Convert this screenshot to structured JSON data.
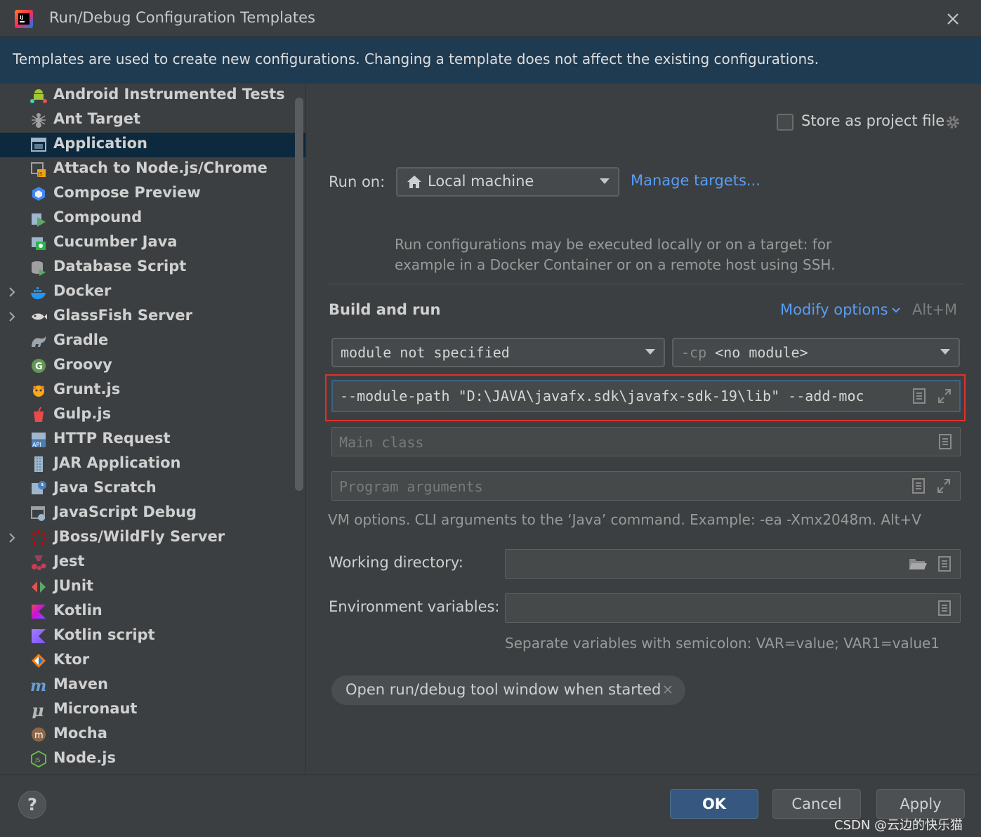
{
  "window": {
    "title": "Run/Debug Configuration Templates"
  },
  "banner": {
    "text": "Templates are used to create new configurations. Changing a template does not affect the existing configurations."
  },
  "sidebar": {
    "items": [
      {
        "label": "Android Instrumented Tests",
        "icon": "android-icon",
        "expandable": false
      },
      {
        "label": "Ant Target",
        "icon": "ant-icon",
        "expandable": false
      },
      {
        "label": "Application",
        "icon": "application-icon",
        "expandable": false,
        "selected": true
      },
      {
        "label": "Attach to Node.js/Chrome",
        "icon": "nodejs-attach-icon",
        "expandable": false
      },
      {
        "label": "Compose Preview",
        "icon": "compose-icon",
        "expandable": false
      },
      {
        "label": "Compound",
        "icon": "compound-icon",
        "expandable": false
      },
      {
        "label": "Cucumber Java",
        "icon": "cucumber-icon",
        "expandable": false
      },
      {
        "label": "Database Script",
        "icon": "database-icon",
        "expandable": false
      },
      {
        "label": "Docker",
        "icon": "docker-icon",
        "expandable": true
      },
      {
        "label": "GlassFish Server",
        "icon": "glassfish-icon",
        "expandable": true
      },
      {
        "label": "Gradle",
        "icon": "gradle-icon",
        "expandable": false
      },
      {
        "label": "Groovy",
        "icon": "groovy-icon",
        "expandable": false
      },
      {
        "label": "Grunt.js",
        "icon": "grunt-icon",
        "expandable": false
      },
      {
        "label": "Gulp.js",
        "icon": "gulp-icon",
        "expandable": false
      },
      {
        "label": "HTTP Request",
        "icon": "http-api-icon",
        "expandable": false
      },
      {
        "label": "JAR Application",
        "icon": "jar-icon",
        "expandable": false
      },
      {
        "label": "Java Scratch",
        "icon": "java-scratch-icon",
        "expandable": false
      },
      {
        "label": "JavaScript Debug",
        "icon": "js-debug-icon",
        "expandable": false
      },
      {
        "label": "JBoss/WildFly Server",
        "icon": "jboss-icon",
        "expandable": true
      },
      {
        "label": "Jest",
        "icon": "jest-icon",
        "expandable": false
      },
      {
        "label": "JUnit",
        "icon": "junit-icon",
        "expandable": false
      },
      {
        "label": "Kotlin",
        "icon": "kotlin-icon",
        "expandable": false
      },
      {
        "label": "Kotlin script",
        "icon": "kotlin-script-icon",
        "expandable": false
      },
      {
        "label": "Ktor",
        "icon": "ktor-icon",
        "expandable": false
      },
      {
        "label": "Maven",
        "icon": "maven-icon",
        "expandable": false
      },
      {
        "label": "Micronaut",
        "icon": "micronaut-icon",
        "expandable": false
      },
      {
        "label": "Mocha",
        "icon": "mocha-icon",
        "expandable": false
      },
      {
        "label": "Node.js",
        "icon": "nodejs-icon",
        "expandable": false
      }
    ]
  },
  "panel": {
    "store_label": "Store as project file",
    "run_on_label": "Run on:",
    "run_on_value": "Local machine",
    "manage_targets": "Manage targets...",
    "run_on_desc_line1": "Run configurations may be executed locally or on a target: for",
    "run_on_desc_line2": "example in a Docker Container or on a remote host using SSH.",
    "build_title": "Build and run",
    "modify_options": "Modify options",
    "modify_shortcut": "Alt+M",
    "module_value": "module not specified",
    "cp_prefix": "-cp",
    "cp_value": "<no module>",
    "vm_options_value": "--module-path \"D:\\JAVA\\javafx.sdk\\javafx-sdk-19\\lib\" --add-moc",
    "main_class_placeholder": "Main class",
    "program_args_placeholder": "Program arguments",
    "vm_hint": "VM options. CLI arguments to the ‘Java’ command. Example: -ea -Xmx2048m. Alt+V",
    "working_dir_label": "Working directory:",
    "env_vars_label": "Environment variables:",
    "env_hint": "Separate variables with semicolon: VAR=value; VAR1=value1",
    "chip_label": "Open run/debug tool window when started"
  },
  "footer": {
    "help": "?",
    "ok": "OK",
    "cancel": "Cancel",
    "apply": "Apply",
    "watermark": "CSDN @云边的快乐猫"
  },
  "colors": {
    "accent_link": "#589df6",
    "selection": "#0d293e",
    "banner_bg": "#1f3b52",
    "highlight_box": "#e0312a",
    "ok_button": "#365880"
  }
}
